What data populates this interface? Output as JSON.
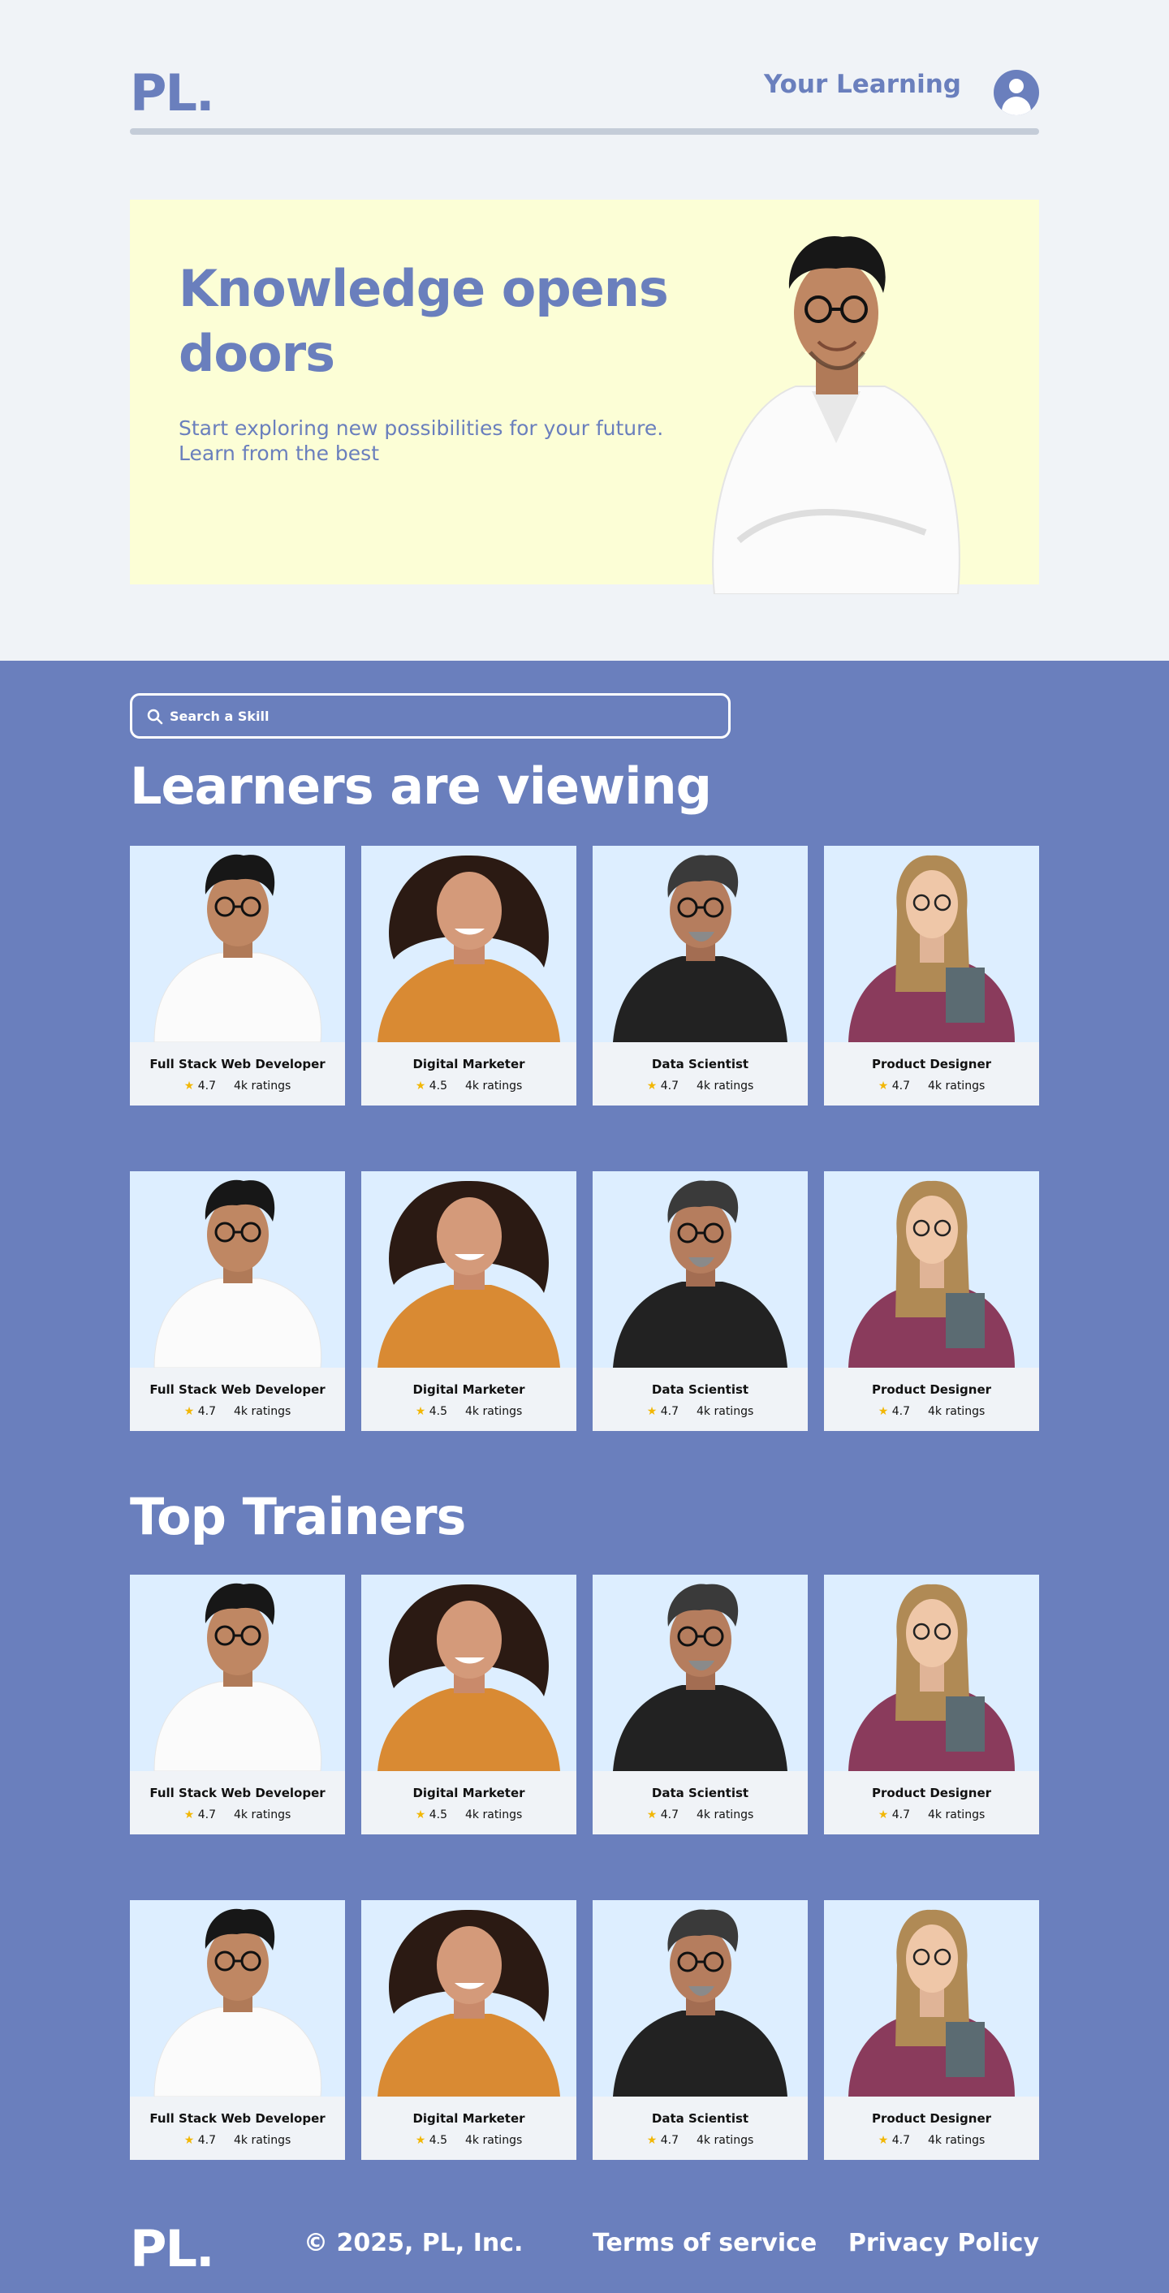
{
  "brand": {
    "logo": "PL.",
    "primary": "#6a7fbd",
    "hero_bg": "#fcfed6",
    "card_bg": "#f0f3f7",
    "photo_bg": "#ddeeff"
  },
  "header": {
    "nav_link": "Your Learning",
    "avatar_icon": "user-icon"
  },
  "hero": {
    "title": "Knowledge opens doors",
    "subtitle": "Start exploring new possibilities for your future. Learn from the best"
  },
  "search": {
    "placeholder": "Search a Skill",
    "icon": "search-icon"
  },
  "sections": {
    "learners_title": "Learners are viewing",
    "trainers_title": "Top Trainers"
  },
  "cards": [
    {
      "name": "Full Stack Web Developer",
      "rating": "4.7",
      "ratings": "4k ratings"
    },
    {
      "name": "Digital Marketer",
      "rating": "4.5",
      "ratings": "4k ratings"
    },
    {
      "name": "Data Scientist",
      "rating": "4.7",
      "ratings": "4k ratings"
    },
    {
      "name": "Product Designer",
      "rating": "4.7",
      "ratings": "4k ratings"
    }
  ],
  "footer": {
    "logo": "PL.",
    "copyright": "© 2025, PL, Inc.",
    "terms": "Terms of service",
    "privacy": "Privacy Policy"
  }
}
